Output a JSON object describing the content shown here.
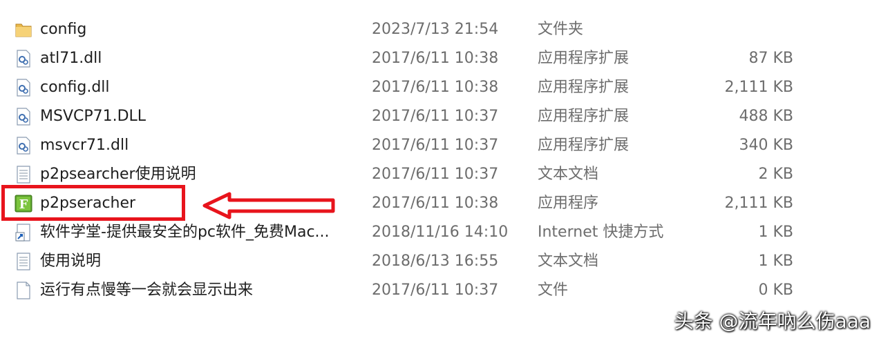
{
  "files": [
    {
      "name": "config",
      "date": "2023/7/13 21:54",
      "type": "文件夹",
      "size": "",
      "icon": "folder-icon"
    },
    {
      "name": "atl71.dll",
      "date": "2017/6/11 10:38",
      "type": "应用程序扩展",
      "size": "87 KB",
      "icon": "dll-file-icon"
    },
    {
      "name": "config.dll",
      "date": "2017/6/11 10:38",
      "type": "应用程序扩展",
      "size": "2,111 KB",
      "icon": "dll-file-icon"
    },
    {
      "name": "MSVCP71.DLL",
      "date": "2017/6/11 10:37",
      "type": "应用程序扩展",
      "size": "488 KB",
      "icon": "dll-file-icon"
    },
    {
      "name": "msvcr71.dll",
      "date": "2017/6/11 10:37",
      "type": "应用程序扩展",
      "size": "340 KB",
      "icon": "dll-file-icon"
    },
    {
      "name": "p2psearcher使用说明",
      "date": "2017/6/11 10:37",
      "type": "文本文档",
      "size": "2 KB",
      "icon": "text-file-icon"
    },
    {
      "name": "p2pseracher",
      "date": "2017/6/11 10:38",
      "type": "应用程序",
      "size": "2,111 KB",
      "icon": "application-icon"
    },
    {
      "name": "软件学堂-提供最安全的pc软件_免费Mac...",
      "date": "2018/11/16 14:10",
      "type": "Internet 快捷方式",
      "size": "1 KB",
      "icon": "internet-shortcut-icon"
    },
    {
      "name": "使用说明",
      "date": "2018/6/13 16:55",
      "type": "文本文档",
      "size": "1 KB",
      "icon": "text-file-icon"
    },
    {
      "name": "运行有点慢等一会就会显示出来",
      "date": "2017/6/11 10:37",
      "type": "文件",
      "size": "0 KB",
      "icon": "blank-file-icon"
    }
  ],
  "highlight_color": "#e8141c",
  "watermark": "头条 @流年吶么伤aaa"
}
